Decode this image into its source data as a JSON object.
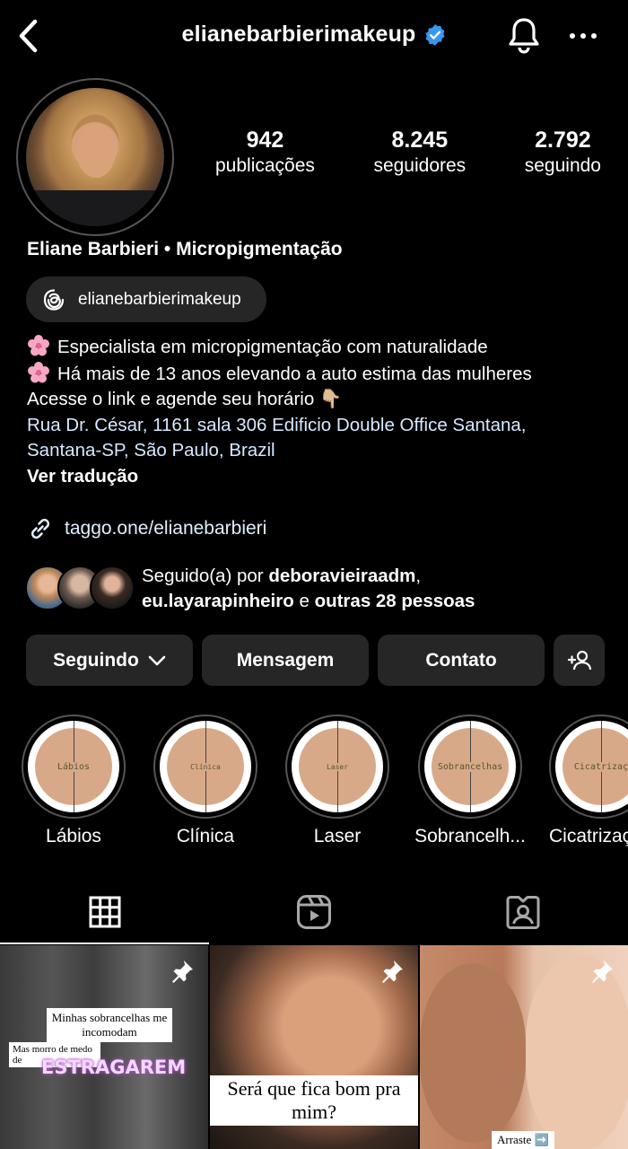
{
  "header": {
    "username": "elianebarbierimakeup"
  },
  "stats": [
    {
      "value": "942",
      "label": "publicações"
    },
    {
      "value": "8.245",
      "label": "seguidores"
    },
    {
      "value": "2.792",
      "label": "seguindo"
    }
  ],
  "profile": {
    "full_name": "Eliane Barbieri • Micropigmentação",
    "threads_handle": "elianebarbierimakeup"
  },
  "bio": {
    "line1": "Especialista em micropigmentação com naturalidade",
    "line2": "Há mais de 13 anos elevando a auto estima das mulheres",
    "line3": "Acesse o link e agende seu horário 👇🏼",
    "address1": "Rua Dr. César, 1161 sala 306 Edificio Double Office Santana,",
    "address2": "Santana-SP, São Paulo, Brazil",
    "translate": "Ver tradução"
  },
  "link": "taggo.one/elianebarbieri",
  "followed_by": {
    "prefix": "Seguido(a) por ",
    "user1": "deboravieiraadm",
    "comma": ",",
    "user2": "eu.layarapinheiro",
    "middle": " e ",
    "others": "outras 28 pessoas"
  },
  "actions": {
    "following": "Seguindo",
    "message": "Mensagem",
    "contact": "Contato"
  },
  "highlights": [
    {
      "label": "Lábios",
      "cover": "Lábios"
    },
    {
      "label": "Clínica",
      "cover": "Clínica"
    },
    {
      "label": "Laser",
      "cover": "Laser"
    },
    {
      "label": "Sobrancelh...",
      "cover": "Sobrancelhas"
    },
    {
      "label": "Cicatrizaç",
      "cover": "Cicatrizaç"
    }
  ],
  "posts": [
    {
      "line1": "Minhas sobrancelhas me incomodam",
      "line2": "Mas morro de medo de",
      "big": "ESTRAGAREM"
    },
    {
      "caption": "Será que fica bom pra mim?"
    },
    {
      "caption": "Arraste ➡️"
    }
  ],
  "colors": {
    "background": "#000000",
    "button": "#262626",
    "verified": "#3897f0",
    "link": "#e0efff",
    "highlight_disc": "#d8a988"
  },
  "icons": [
    "back-icon",
    "verified-badge-icon",
    "bell-icon",
    "more-icon",
    "threads-icon",
    "link-icon",
    "chevron-down-icon",
    "add-person-icon",
    "grid-icon",
    "reels-icon",
    "tagged-icon",
    "pin-icon"
  ]
}
